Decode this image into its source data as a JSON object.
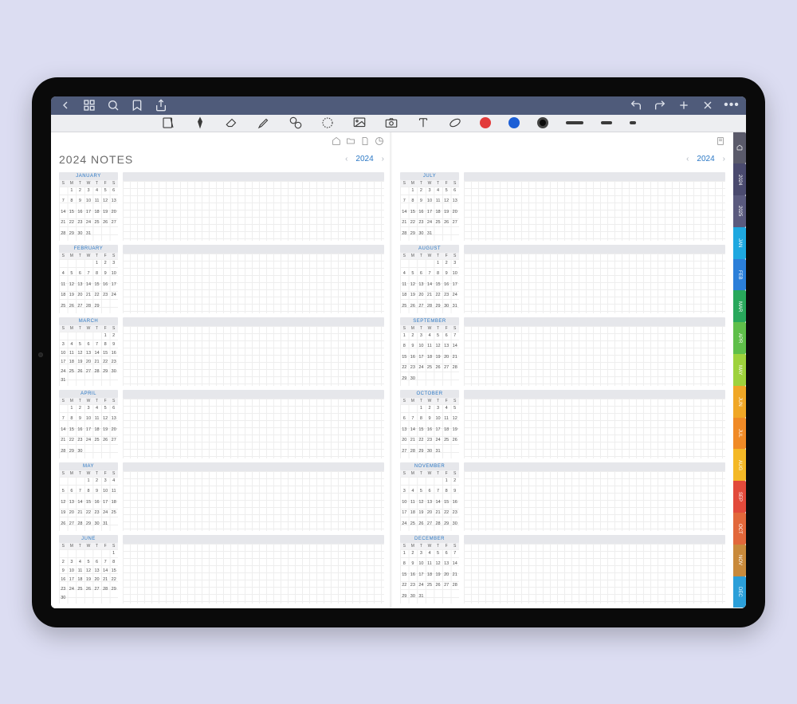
{
  "page_title": "2024 NOTES",
  "year_label": "2024",
  "dow": [
    "S",
    "M",
    "T",
    "W",
    "T",
    "F",
    "S"
  ],
  "months_left": [
    {
      "name": "JANUARY",
      "offset": 1,
      "count": 31
    },
    {
      "name": "FEBRUARY",
      "offset": 4,
      "count": 29
    },
    {
      "name": "MARCH",
      "offset": 5,
      "count": 31
    },
    {
      "name": "APRIL",
      "offset": 1,
      "count": 30
    },
    {
      "name": "MAY",
      "offset": 3,
      "count": 31
    },
    {
      "name": "JUNE",
      "offset": 6,
      "count": 30
    }
  ],
  "months_right": [
    {
      "name": "JULY",
      "offset": 1,
      "count": 31
    },
    {
      "name": "AUGUST",
      "offset": 4,
      "count": 31
    },
    {
      "name": "SEPTEMBER",
      "offset": 0,
      "count": 30
    },
    {
      "name": "OCTOBER",
      "offset": 2,
      "count": 31
    },
    {
      "name": "NOVEMBER",
      "offset": 5,
      "count": 30
    },
    {
      "name": "DECEMBER",
      "offset": 0,
      "count": 31
    }
  ],
  "side_tabs": [
    {
      "label": "",
      "color": "#5a5a6a",
      "icon": "home"
    },
    {
      "label": "2024",
      "color": "#4a4a6e"
    },
    {
      "label": "2025",
      "color": "#5a5a7e"
    },
    {
      "label": "JAN",
      "color": "#1EA8E0"
    },
    {
      "label": "FEB",
      "color": "#2B7FD9"
    },
    {
      "label": "MAR",
      "color": "#29A85C"
    },
    {
      "label": "APR",
      "color": "#5FBF4A"
    },
    {
      "label": "MAY",
      "color": "#9ED23C"
    },
    {
      "label": "JUN",
      "color": "#F0A726"
    },
    {
      "label": "JUL",
      "color": "#F08A26"
    },
    {
      "label": "AUG",
      "color": "#F4B826"
    },
    {
      "label": "SEP",
      "color": "#E24A3B"
    },
    {
      "label": "OCT",
      "color": "#E2683B"
    },
    {
      "label": "NOV",
      "color": "#C98A3B"
    },
    {
      "label": "DEC",
      "color": "#2B9FD9"
    }
  ],
  "toolbar": {
    "strokes": [
      22,
      14,
      8
    ]
  }
}
